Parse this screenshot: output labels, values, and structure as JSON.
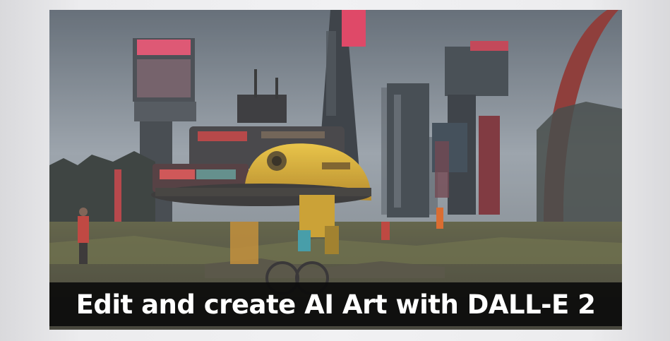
{
  "thumbnail": {
    "caption": "Edit and create AI Art with DALL-E 2"
  },
  "colors": {
    "page_background": "#ececee",
    "caption_background": "#0c0c0c",
    "caption_text": "#ffffff",
    "robot_yellow": "#e2b52a",
    "neon_pink": "#e83c5a",
    "sky": "#8a939c"
  }
}
